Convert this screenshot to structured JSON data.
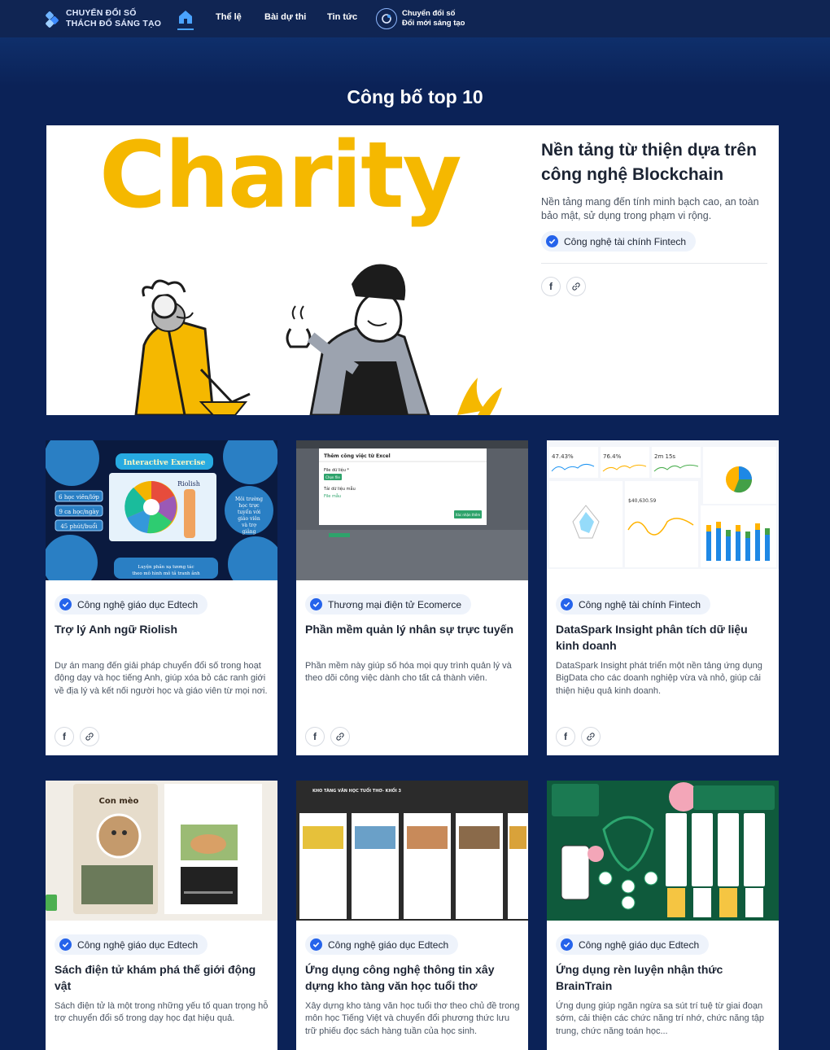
{
  "nav": {
    "logo_line1": "CHUYỂN ĐỔI SỐ",
    "logo_line2": "THÁCH ĐỐ SÁNG TẠO",
    "links": [
      "Thể lệ",
      "Bài dự thi",
      "Tin tức"
    ],
    "badge_line1": "Chuyển đổi số",
    "badge_line2": "Đổi mới sáng tạo",
    "accent": "#4aa3ff"
  },
  "page_title": "Công bố top 10",
  "hero": {
    "image_word": "Charity",
    "title": "Nền tảng từ thiện dựa trên công nghệ Blockchain",
    "description": "Nền tảng mang đến tính minh bạch cao, an toàn bảo mật, sử dụng trong phạm vi rộng.",
    "tag": "Công nghệ tài chính Fintech",
    "share_fb": "f",
    "share_link": "🔗"
  },
  "cards": [
    {
      "tag": "Công nghệ giáo dục Edtech",
      "title": "Trợ lý Anh ngữ Riolish",
      "description": "Dự án mang đến giải pháp chuyển đổi số trong hoạt động dạy và học tiếng Anh, giúp xóa bỏ các ranh giới về địa lý và kết nối người học và giáo viên từ mọi nơi.",
      "img_banner": "Interactive Exercise",
      "img_center": "Riolish",
      "img_left": [
        "6 học viên/lớp",
        "9 ca học/ngày",
        "45 phút/buổi"
      ],
      "img_right": "Môi trường học trực tuyến với giáo viên và trợ giảng",
      "img_bottom": "Luyện phản xạ tương tác theo mô hình mô tả tranh ảnh"
    },
    {
      "tag": "Thương mại điện tử Ecomerce",
      "title": "Phần mềm quản lý nhân sự trực tuyến",
      "description": "Phần mềm này giúp số hóa mọi quy trình quản lý và theo dõi công việc dành cho tất cả thành viên.",
      "img_dialog_title": "Thêm công việc từ Excel",
      "img_field1": "File dữ liệu *",
      "img_btn": "Chọn file",
      "img_field2": "Tải dữ liệu mẫu",
      "img_link": "File mẫu",
      "img_submit": "Xác nhận thêm"
    },
    {
      "tag": "Công nghệ tài chính Fintech",
      "title": "DataSpark Insight phân tích dữ liệu kinh doanh",
      "description": "DataSpark Insight phát triển một nền tảng ứng dụng BigData cho các doanh nghiệp vừa và nhỏ, giúp cải thiện hiệu quả kinh doanh.",
      "img_kpi": [
        "47.43%",
        "76.4%",
        "2m 15s"
      ],
      "img_value": "$40,630.59"
    },
    {
      "tag": "Công nghệ giáo dục Edtech",
      "title": "Sách điện tử khám phá thế giới động vật",
      "description": "Sách điện tử là một trong những yếu tố quan trọng hỗ trợ chuyển đổi số trong dạy học đạt hiệu quả.",
      "img_heading": "Con mèo"
    },
    {
      "tag": "Công nghệ giáo dục Edtech",
      "title": "Ứng dụng công nghệ thông tin xây dựng kho tàng văn học tuổi thơ",
      "description": "Xây dựng kho tàng văn học tuổi thơ theo chủ đề trong môn học Tiếng Việt và chuyển đổi phương thức lưu trữ phiếu đọc sách hàng tuần của học sinh.",
      "img_heading": "KHO TÀNG VĂN HỌC TUỔI THƠ- KHỐI 3"
    },
    {
      "tag": "Công nghệ giáo dục Edtech",
      "title": "Ứng dụng rèn luyện nhận thức BrainTrain",
      "description": "Ứng dụng giúp ngăn ngừa sa sút trí tuệ từ giai đoạn sớm, cải thiện các chức năng trí nhớ, chức năng tập trung, chức năng toán học..."
    }
  ],
  "colors": {
    "page_bg": "#0b2257",
    "nav_bg": "#102553",
    "tag_check": "#2563eb",
    "charity_yellow": "#f5b800"
  }
}
